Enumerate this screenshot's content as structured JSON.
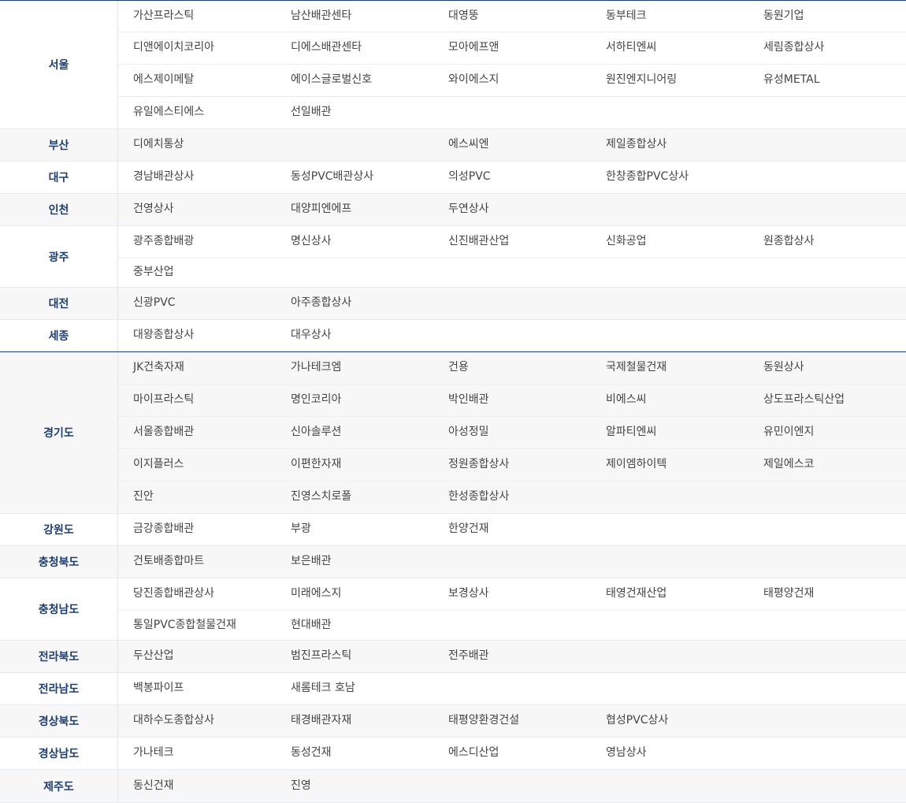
{
  "regions": [
    {
      "name": "서울",
      "rows": [
        [
          "가산프라스틱",
          "남산배관센타",
          "대영뚱",
          "동부테크",
          "동원기업"
        ],
        [
          "디앤에이치코리아",
          "디에스배관센타",
          "모아에프앤",
          "서하티엔씨",
          "세림종합상사"
        ],
        [
          "에스제이메탈",
          "에이스글로벌신호",
          "와이에스지",
          "원진엔지니어링",
          "유성METAL"
        ],
        [
          "유일에스티에스",
          "선일배관",
          "",
          "",
          ""
        ]
      ]
    },
    {
      "name": "부산",
      "rows": [
        [
          "디에치통상",
          "",
          "에스씨엔",
          "제일종합상사",
          ""
        ]
      ]
    },
    {
      "name": "대구",
      "rows": [
        [
          "경남배관상사",
          "동성PVC배관상사",
          "의성PVC",
          "한창종합PVC상사",
          ""
        ]
      ]
    },
    {
      "name": "인천",
      "rows": [
        [
          "건영상사",
          "대양피엔에프",
          "두연상사",
          "",
          ""
        ]
      ]
    },
    {
      "name": "광주",
      "rows": [
        [
          "광주종합배광",
          "명신상사",
          "신진배관산업",
          "신화공업",
          "원종합상사"
        ],
        [
          "중부산업",
          "",
          "",
          "",
          ""
        ]
      ]
    },
    {
      "name": "대전",
      "rows": [
        [
          "신광PVC",
          "아주종합상사",
          "",
          "",
          ""
        ]
      ]
    },
    {
      "name": "세종",
      "rows": [
        [
          "대왕종합상사",
          "대우상사",
          "",
          "",
          ""
        ]
      ]
    },
    {
      "name": "경기도",
      "rows": [
        [
          "JK건축자재",
          "가나테크엠",
          "건용",
          "국제철물건재",
          "동원상사"
        ],
        [
          "마이프라스틱",
          "명인코리아",
          "박인배관",
          "비에스씨",
          "상도프라스틱산업"
        ],
        [
          "서울종합배관",
          "신아솔루션",
          "아성정밀",
          "알파티엔씨",
          "유민이엔지"
        ],
        [
          "이지플러스",
          "이편한자재",
          "정원종합상사",
          "제이엠하이텍",
          "제일에스코"
        ],
        [
          "진안",
          "진영스치로폴",
          "한성종합상사",
          "",
          ""
        ]
      ]
    },
    {
      "name": "강원도",
      "rows": [
        [
          "금강종합배관",
          "부광",
          "한양건재",
          "",
          ""
        ]
      ]
    },
    {
      "name": "충청북도",
      "rows": [
        [
          "건토배종합마트",
          "보은배관",
          "",
          "",
          ""
        ]
      ]
    },
    {
      "name": "충청남도",
      "rows": [
        [
          "당진종합배관상사",
          "미래에스지",
          "보경상사",
          "태영건재산업",
          "태평양건재"
        ],
        [
          "통일PVC종합철물건재",
          "현대배관",
          "",
          "",
          ""
        ]
      ]
    },
    {
      "name": "전라북도",
      "rows": [
        [
          "두산산업",
          "범진프라스틱",
          "전주배관",
          "",
          ""
        ]
      ]
    },
    {
      "name": "전라남도",
      "rows": [
        [
          "백봉파이프",
          "새롬테크 호남",
          "",
          "",
          ""
        ]
      ]
    },
    {
      "name": "경상북도",
      "rows": [
        [
          "대하수도종합상사",
          "태경배관자재",
          "태평양환경건설",
          "협성PVC상사",
          ""
        ]
      ]
    },
    {
      "name": "경상남도",
      "rows": [
        [
          "가나테크",
          "동성건재",
          "에스디산업",
          "영남상사",
          ""
        ]
      ]
    },
    {
      "name": "제주도",
      "rows": [
        [
          "동신건재",
          "진영",
          "",
          "",
          ""
        ]
      ]
    }
  ]
}
